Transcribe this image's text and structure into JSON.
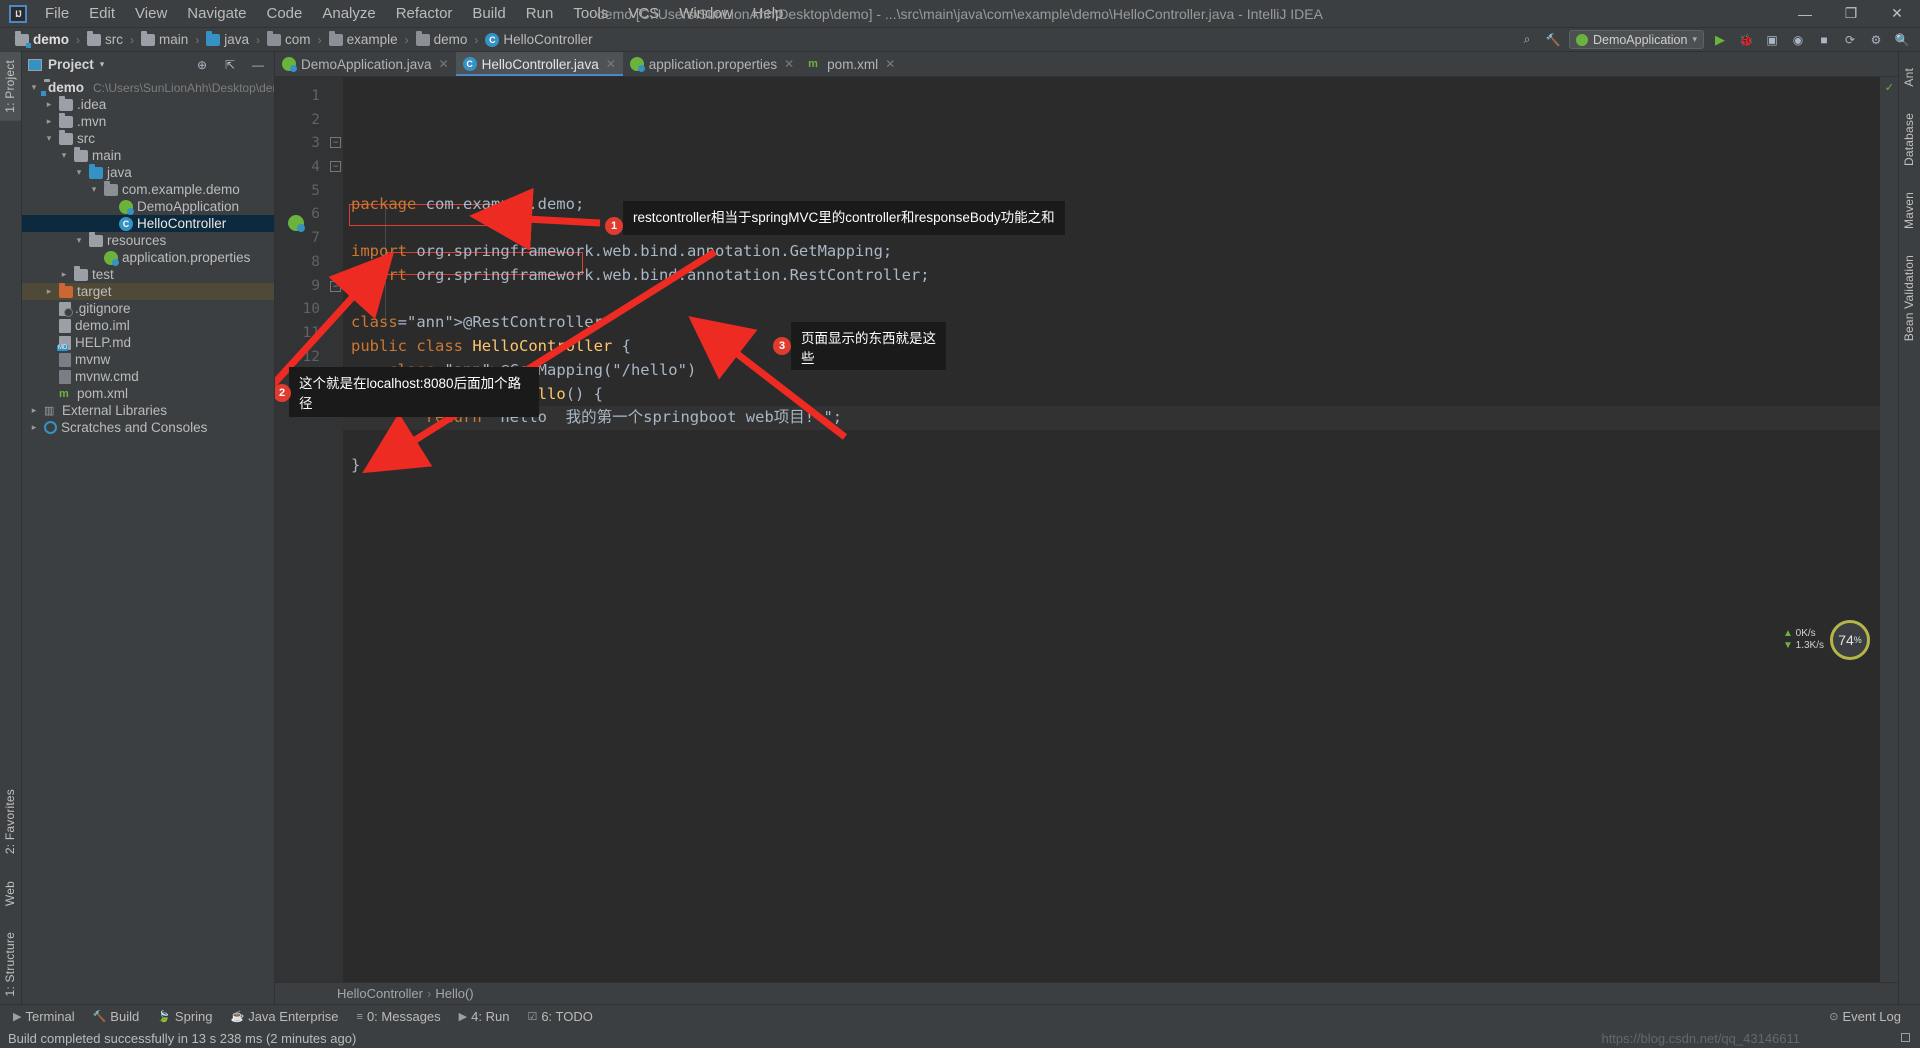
{
  "window": {
    "title": "demo [C:\\Users\\SunLionAhh\\Desktop\\demo] - ...\\src\\main\\java\\com\\example\\demo\\HelloController.java - IntelliJ IDEA",
    "logo": "IJ",
    "minimize": "—",
    "maximize": "❐",
    "close": "✕"
  },
  "menu": [
    "File",
    "Edit",
    "View",
    "Navigate",
    "Code",
    "Analyze",
    "Refactor",
    "Build",
    "Run",
    "Tools",
    "VCS",
    "Window",
    "Help"
  ],
  "navbar": {
    "crumbs": [
      "demo",
      "src",
      "main",
      "java",
      "com",
      "example",
      "demo",
      "HelloController"
    ],
    "separator": "›",
    "run_config": "DemoApplication",
    "run_label": "▶",
    "debug_label": "🐞",
    "stop_label": "■"
  },
  "rail": {
    "left_top": [
      "1: Project"
    ],
    "left_bottom": [
      "2: Favorites",
      "Web",
      "1: Structure"
    ],
    "right": [
      "Ant",
      "Database",
      "Maven",
      "Bean Validation"
    ]
  },
  "project_panel": {
    "title": "Project",
    "dropdown": "▾",
    "tree": [
      {
        "indent": 0,
        "twisty": "▾",
        "icon": "folder-module",
        "label": "demo",
        "sub": "C:\\Users\\SunLionAhh\\Desktop\\demo",
        "bold": true,
        "state": ""
      },
      {
        "indent": 1,
        "twisty": "▸",
        "icon": "folder",
        "label": ".idea",
        "sub": "",
        "bold": false,
        "state": ""
      },
      {
        "indent": 1,
        "twisty": "▸",
        "icon": "folder",
        "label": ".mvn",
        "sub": "",
        "bold": false,
        "state": ""
      },
      {
        "indent": 1,
        "twisty": "▾",
        "icon": "folder",
        "label": "src",
        "sub": "",
        "bold": false,
        "state": ""
      },
      {
        "indent": 2,
        "twisty": "▾",
        "icon": "folder",
        "label": "main",
        "sub": "",
        "bold": false,
        "state": ""
      },
      {
        "indent": 3,
        "twisty": "▾",
        "icon": "folder-source",
        "label": "java",
        "sub": "",
        "bold": false,
        "state": ""
      },
      {
        "indent": 4,
        "twisty": "▾",
        "icon": "package",
        "label": "com.example.demo",
        "sub": "",
        "bold": false,
        "state": ""
      },
      {
        "indent": 5,
        "twisty": "",
        "icon": "spring-class",
        "label": "DemoApplication",
        "sub": "",
        "bold": false,
        "state": ""
      },
      {
        "indent": 5,
        "twisty": "",
        "icon": "class",
        "label": "HelloController",
        "sub": "",
        "bold": false,
        "state": "selected"
      },
      {
        "indent": 3,
        "twisty": "▾",
        "icon": "folder-resources",
        "label": "resources",
        "sub": "",
        "bold": false,
        "state": ""
      },
      {
        "indent": 4,
        "twisty": "",
        "icon": "properties",
        "label": "application.properties",
        "sub": "",
        "bold": false,
        "state": ""
      },
      {
        "indent": 2,
        "twisty": "▸",
        "icon": "folder",
        "label": "test",
        "sub": "",
        "bold": false,
        "state": ""
      },
      {
        "indent": 1,
        "twisty": "▸",
        "icon": "folder-target",
        "label": "target",
        "sub": "",
        "bold": false,
        "state": "highlight"
      },
      {
        "indent": 1,
        "twisty": "",
        "icon": "file-git",
        "label": ".gitignore",
        "sub": "",
        "bold": false,
        "state": ""
      },
      {
        "indent": 1,
        "twisty": "",
        "icon": "file-iml",
        "label": "demo.iml",
        "sub": "",
        "bold": false,
        "state": ""
      },
      {
        "indent": 1,
        "twisty": "",
        "icon": "file-md",
        "label": "HELP.md",
        "sub": "",
        "bold": false,
        "state": ""
      },
      {
        "indent": 1,
        "twisty": "",
        "icon": "file-script",
        "label": "mvnw",
        "sub": "",
        "bold": false,
        "state": ""
      },
      {
        "indent": 1,
        "twisty": "",
        "icon": "file-script",
        "label": "mvnw.cmd",
        "sub": "",
        "bold": false,
        "state": ""
      },
      {
        "indent": 1,
        "twisty": "",
        "icon": "file-xml",
        "label": "pom.xml",
        "sub": "",
        "bold": false,
        "state": ""
      },
      {
        "indent": 0,
        "twisty": "▸",
        "icon": "libraries",
        "label": "External Libraries",
        "sub": "",
        "bold": false,
        "state": ""
      },
      {
        "indent": 0,
        "twisty": "▸",
        "icon": "scratches",
        "label": "Scratches and Consoles",
        "sub": "",
        "bold": false,
        "state": ""
      }
    ]
  },
  "tabs": [
    {
      "label": "DemoApplication.java",
      "icon": "spring-class",
      "active": false,
      "close": "✕"
    },
    {
      "label": "HelloController.java",
      "icon": "class",
      "active": true,
      "close": "✕"
    },
    {
      "label": "application.properties",
      "icon": "properties",
      "active": false,
      "close": "✕"
    },
    {
      "label": "pom.xml",
      "icon": "maven",
      "active": false,
      "close": "✕"
    }
  ],
  "editor": {
    "line_numbers": [
      "1",
      "2",
      "3",
      "4",
      "5",
      "6",
      "7",
      "8",
      "9",
      "10",
      "11",
      "12",
      "13"
    ],
    "lines": [
      "package com.example.demo;",
      "",
      "import org.springframework.web.bind.annotation.GetMapping;",
      "import org.springframework.web.bind.annotation.RestController;",
      "",
      "@RestController",
      "public class HelloController {",
      "    @GetMapping(\"/hello\")",
      "    public String Hello() {",
      "        return \"hello  我的第一个springboot web项目! \";",
      "    }",
      "}",
      ""
    ],
    "breadcrumb": [
      "HelloController",
      "Hello()"
    ],
    "breadcrumb_sep": "›"
  },
  "callouts": [
    {
      "num": "1",
      "text": "restcontroller相当于springMVC里的controller和responseBody功能之和"
    },
    {
      "num": "2",
      "text": "这个就是在localhost:8080后面加个路径"
    },
    {
      "num": "3",
      "text": "页面显示的东西就是这些"
    }
  ],
  "bottom_tools": [
    {
      "icon": "▶",
      "label": "Terminal"
    },
    {
      "icon": "🔨",
      "label": "Build"
    },
    {
      "icon": "🍃",
      "label": "Spring"
    },
    {
      "icon": "☕",
      "label": "Java Enterprise"
    },
    {
      "icon": "≡",
      "label": "0: Messages"
    },
    {
      "icon": "▶",
      "label": "4: Run"
    },
    {
      "icon": "☑",
      "label": "6: TODO"
    }
  ],
  "event_log": "Event Log",
  "status": {
    "message": "Build completed successfully in 13 s 238 ms (2 minutes ago)",
    "watermark": "https://blog.csdn.net/qq_43146611"
  },
  "memory_widget": {
    "upload": "0K/s",
    "download": "1.3K/s",
    "zoom": "74",
    "zoom_unit": "%"
  },
  "colors": {
    "accent": "#4a88c7",
    "annotation": "#bbb529",
    "keyword": "#cc7832",
    "string": "#6a8759",
    "red_marker": "#e03b2f",
    "selection": "#0d293e",
    "spring_green": "#6cb33e"
  }
}
